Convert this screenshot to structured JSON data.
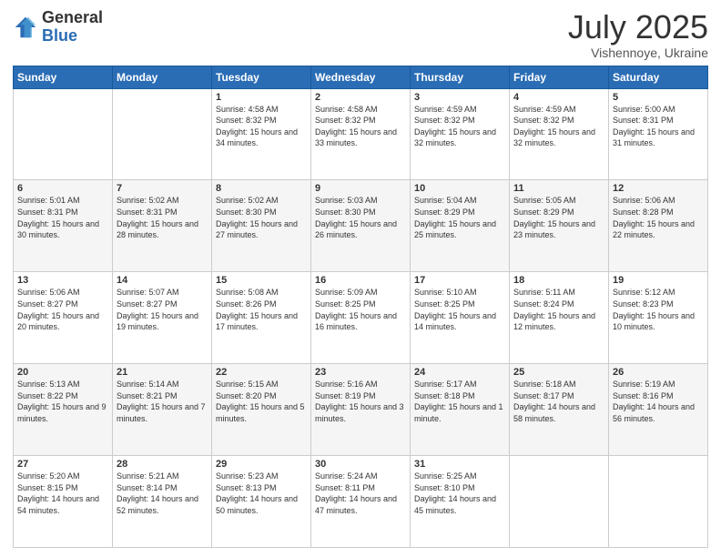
{
  "header": {
    "logo": {
      "general": "General",
      "blue": "Blue"
    },
    "title": "July 2025",
    "location": "Vishennoye, Ukraine"
  },
  "days_of_week": [
    "Sunday",
    "Monday",
    "Tuesday",
    "Wednesday",
    "Thursday",
    "Friday",
    "Saturday"
  ],
  "weeks": [
    [
      {
        "day": "",
        "info": ""
      },
      {
        "day": "",
        "info": ""
      },
      {
        "day": "1",
        "info": "Sunrise: 4:58 AM\nSunset: 8:32 PM\nDaylight: 15 hours and 34 minutes."
      },
      {
        "day": "2",
        "info": "Sunrise: 4:58 AM\nSunset: 8:32 PM\nDaylight: 15 hours and 33 minutes."
      },
      {
        "day": "3",
        "info": "Sunrise: 4:59 AM\nSunset: 8:32 PM\nDaylight: 15 hours and 32 minutes."
      },
      {
        "day": "4",
        "info": "Sunrise: 4:59 AM\nSunset: 8:32 PM\nDaylight: 15 hours and 32 minutes."
      },
      {
        "day": "5",
        "info": "Sunrise: 5:00 AM\nSunset: 8:31 PM\nDaylight: 15 hours and 31 minutes."
      }
    ],
    [
      {
        "day": "6",
        "info": "Sunrise: 5:01 AM\nSunset: 8:31 PM\nDaylight: 15 hours and 30 minutes."
      },
      {
        "day": "7",
        "info": "Sunrise: 5:02 AM\nSunset: 8:31 PM\nDaylight: 15 hours and 28 minutes."
      },
      {
        "day": "8",
        "info": "Sunrise: 5:02 AM\nSunset: 8:30 PM\nDaylight: 15 hours and 27 minutes."
      },
      {
        "day": "9",
        "info": "Sunrise: 5:03 AM\nSunset: 8:30 PM\nDaylight: 15 hours and 26 minutes."
      },
      {
        "day": "10",
        "info": "Sunrise: 5:04 AM\nSunset: 8:29 PM\nDaylight: 15 hours and 25 minutes."
      },
      {
        "day": "11",
        "info": "Sunrise: 5:05 AM\nSunset: 8:29 PM\nDaylight: 15 hours and 23 minutes."
      },
      {
        "day": "12",
        "info": "Sunrise: 5:06 AM\nSunset: 8:28 PM\nDaylight: 15 hours and 22 minutes."
      }
    ],
    [
      {
        "day": "13",
        "info": "Sunrise: 5:06 AM\nSunset: 8:27 PM\nDaylight: 15 hours and 20 minutes."
      },
      {
        "day": "14",
        "info": "Sunrise: 5:07 AM\nSunset: 8:27 PM\nDaylight: 15 hours and 19 minutes."
      },
      {
        "day": "15",
        "info": "Sunrise: 5:08 AM\nSunset: 8:26 PM\nDaylight: 15 hours and 17 minutes."
      },
      {
        "day": "16",
        "info": "Sunrise: 5:09 AM\nSunset: 8:25 PM\nDaylight: 15 hours and 16 minutes."
      },
      {
        "day": "17",
        "info": "Sunrise: 5:10 AM\nSunset: 8:25 PM\nDaylight: 15 hours and 14 minutes."
      },
      {
        "day": "18",
        "info": "Sunrise: 5:11 AM\nSunset: 8:24 PM\nDaylight: 15 hours and 12 minutes."
      },
      {
        "day": "19",
        "info": "Sunrise: 5:12 AM\nSunset: 8:23 PM\nDaylight: 15 hours and 10 minutes."
      }
    ],
    [
      {
        "day": "20",
        "info": "Sunrise: 5:13 AM\nSunset: 8:22 PM\nDaylight: 15 hours and 9 minutes."
      },
      {
        "day": "21",
        "info": "Sunrise: 5:14 AM\nSunset: 8:21 PM\nDaylight: 15 hours and 7 minutes."
      },
      {
        "day": "22",
        "info": "Sunrise: 5:15 AM\nSunset: 8:20 PM\nDaylight: 15 hours and 5 minutes."
      },
      {
        "day": "23",
        "info": "Sunrise: 5:16 AM\nSunset: 8:19 PM\nDaylight: 15 hours and 3 minutes."
      },
      {
        "day": "24",
        "info": "Sunrise: 5:17 AM\nSunset: 8:18 PM\nDaylight: 15 hours and 1 minute."
      },
      {
        "day": "25",
        "info": "Sunrise: 5:18 AM\nSunset: 8:17 PM\nDaylight: 14 hours and 58 minutes."
      },
      {
        "day": "26",
        "info": "Sunrise: 5:19 AM\nSunset: 8:16 PM\nDaylight: 14 hours and 56 minutes."
      }
    ],
    [
      {
        "day": "27",
        "info": "Sunrise: 5:20 AM\nSunset: 8:15 PM\nDaylight: 14 hours and 54 minutes."
      },
      {
        "day": "28",
        "info": "Sunrise: 5:21 AM\nSunset: 8:14 PM\nDaylight: 14 hours and 52 minutes."
      },
      {
        "day": "29",
        "info": "Sunrise: 5:23 AM\nSunset: 8:13 PM\nDaylight: 14 hours and 50 minutes."
      },
      {
        "day": "30",
        "info": "Sunrise: 5:24 AM\nSunset: 8:11 PM\nDaylight: 14 hours and 47 minutes."
      },
      {
        "day": "31",
        "info": "Sunrise: 5:25 AM\nSunset: 8:10 PM\nDaylight: 14 hours and 45 minutes."
      },
      {
        "day": "",
        "info": ""
      },
      {
        "day": "",
        "info": ""
      }
    ]
  ]
}
